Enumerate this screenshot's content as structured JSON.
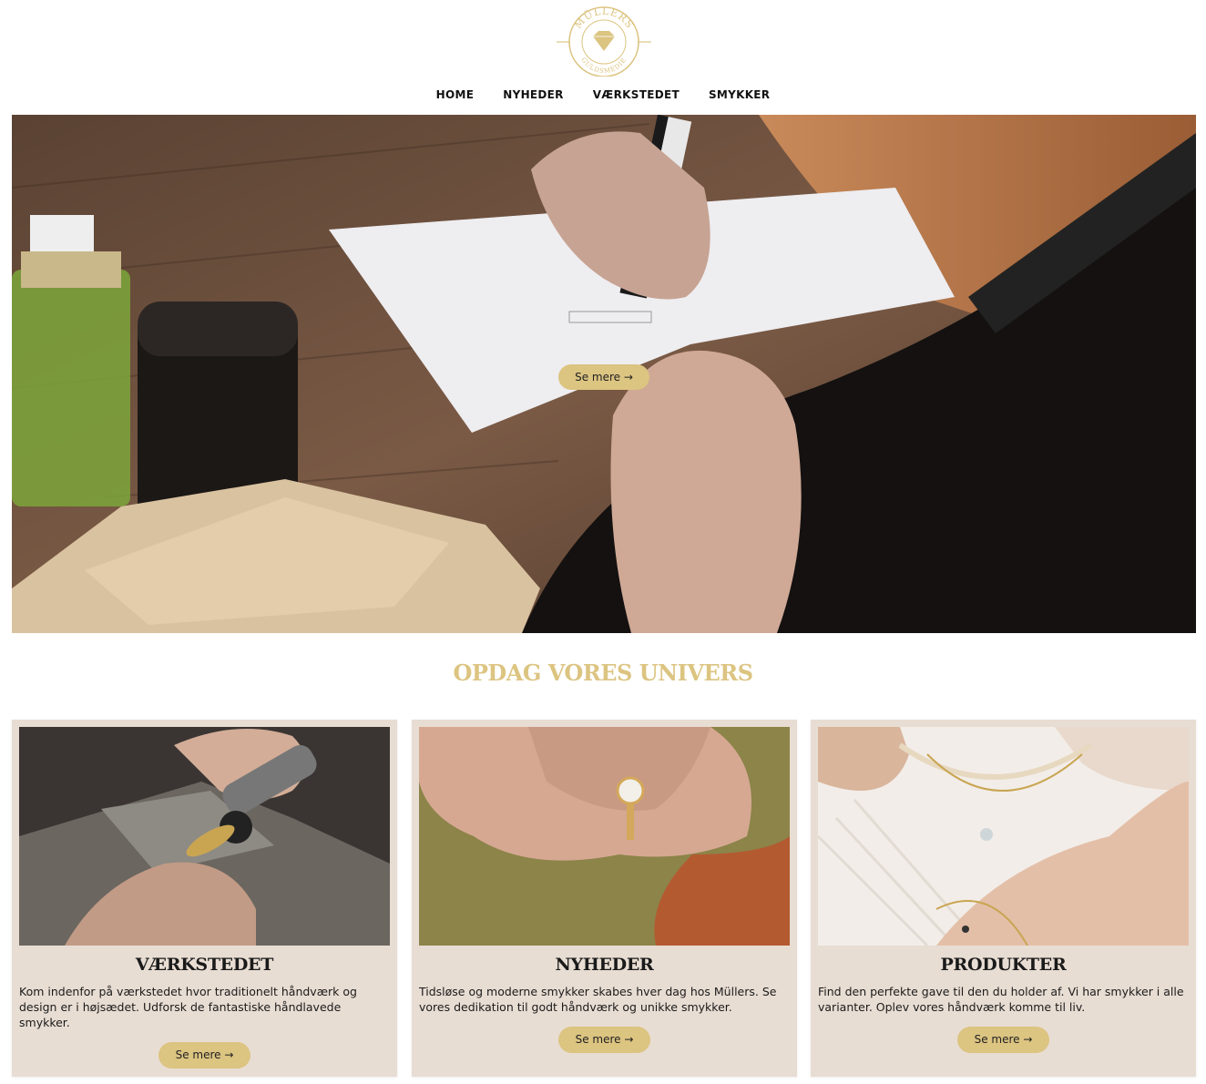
{
  "brand": {
    "logo_top_text": "MÜLLERS",
    "logo_bottom_text": "GULDSMEDIE",
    "gold": "#dcc481",
    "card_bg": "#e8ddd3"
  },
  "nav": {
    "items": [
      {
        "label": "HOME"
      },
      {
        "label": "NYHEDER"
      },
      {
        "label": "VÆRKSTEDET"
      },
      {
        "label": "SMYKKER"
      }
    ]
  },
  "hero": {
    "button_label": "Se mere →"
  },
  "section": {
    "title": "OPDAG VORES UNIVERS"
  },
  "cards": [
    {
      "title": "VÆRKSTEDET",
      "text": "Kom indenfor på værkstedet hvor traditionelt håndværk og design er i højsædet. Udforsk de fantastiske håndlavede smykker.",
      "button_label": "Se mere →"
    },
    {
      "title": "NYHEDER",
      "text": "Tidsløse og moderne smykker skabes hver dag hos Müllers. Se vores dedikation til godt håndværk og unikke smykker.",
      "button_label": "Se mere →"
    },
    {
      "title": "PRODUKTER",
      "text": "Find den perfekte gave til den du holder af. Vi har smykker i alle varianter. Oplev vores håndværk komme til liv.",
      "button_label": "Se mere →"
    }
  ]
}
